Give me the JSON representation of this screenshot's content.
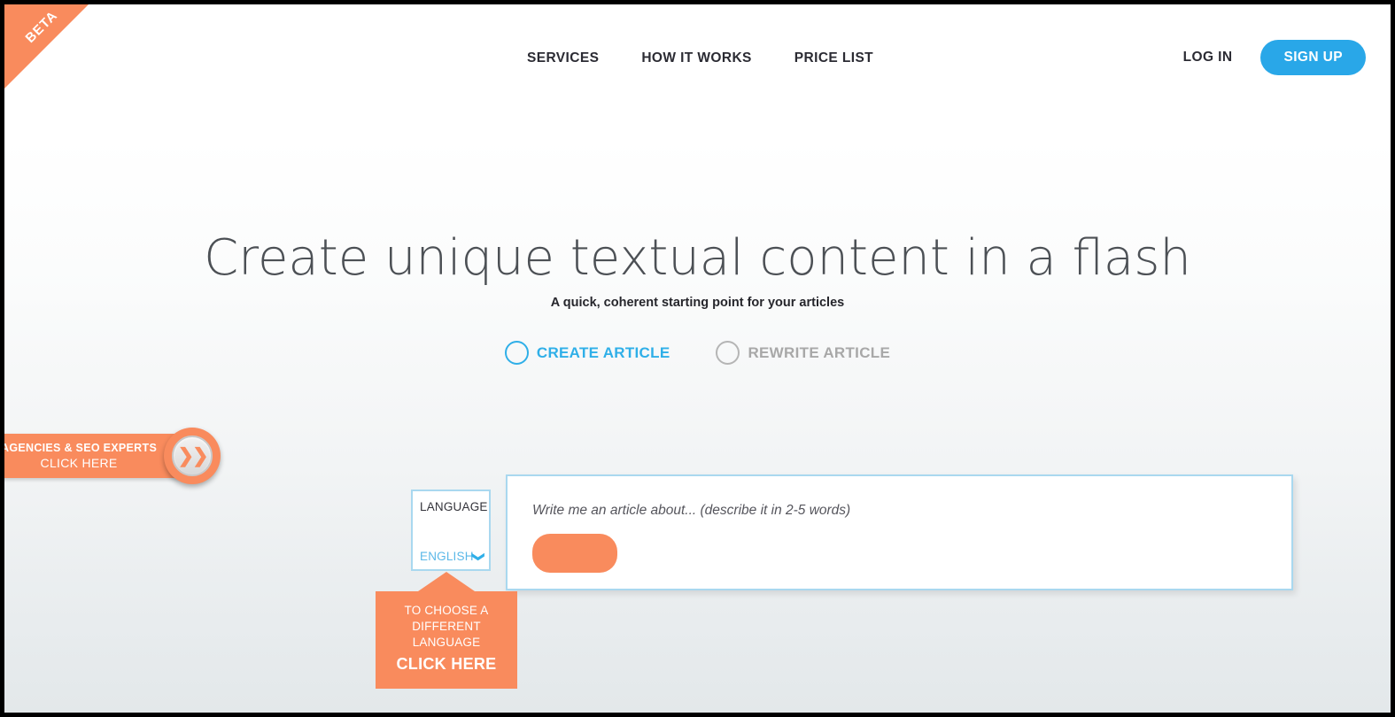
{
  "brand": {
    "beta_label": "BETA",
    "accent_orange": "#f98b5d",
    "accent_blue": "#29a7e8",
    "border_blue": "#a9d8ef"
  },
  "nav": {
    "links": [
      {
        "label": "SERVICES"
      },
      {
        "label": "HOW IT WORKS"
      },
      {
        "label": "PRICE LIST"
      }
    ],
    "login_label": "LOG IN",
    "signup_label": "SIGN UP"
  },
  "hero": {
    "headline": "Create unique textual content in a flash",
    "subtitle": "A quick, coherent starting point for your articles"
  },
  "modes": {
    "create": {
      "label": "CREATE ARTICLE",
      "selected": true
    },
    "rewrite": {
      "label": "REWRITE ARTICLE",
      "selected": false
    }
  },
  "side_badge": {
    "line1": "AGENCIES & SEO EXPERTS",
    "line2": "CLICK HERE",
    "chevron_icon": "double-chevron-right-icon"
  },
  "language": {
    "label": "LANGUAGE",
    "value": "ENGLISH",
    "chevron_icon": "chevron-down-icon",
    "options": [
      "ENGLISH"
    ]
  },
  "language_tooltip": {
    "line1": "TO CHOOSE A",
    "line2": "DIFFERENT LANGUAGE",
    "line3": "CLICK HERE"
  },
  "input_panel": {
    "placeholder": "Write me an article about... (describe it in 2-5 words)",
    "value": "",
    "generate_label": ""
  }
}
